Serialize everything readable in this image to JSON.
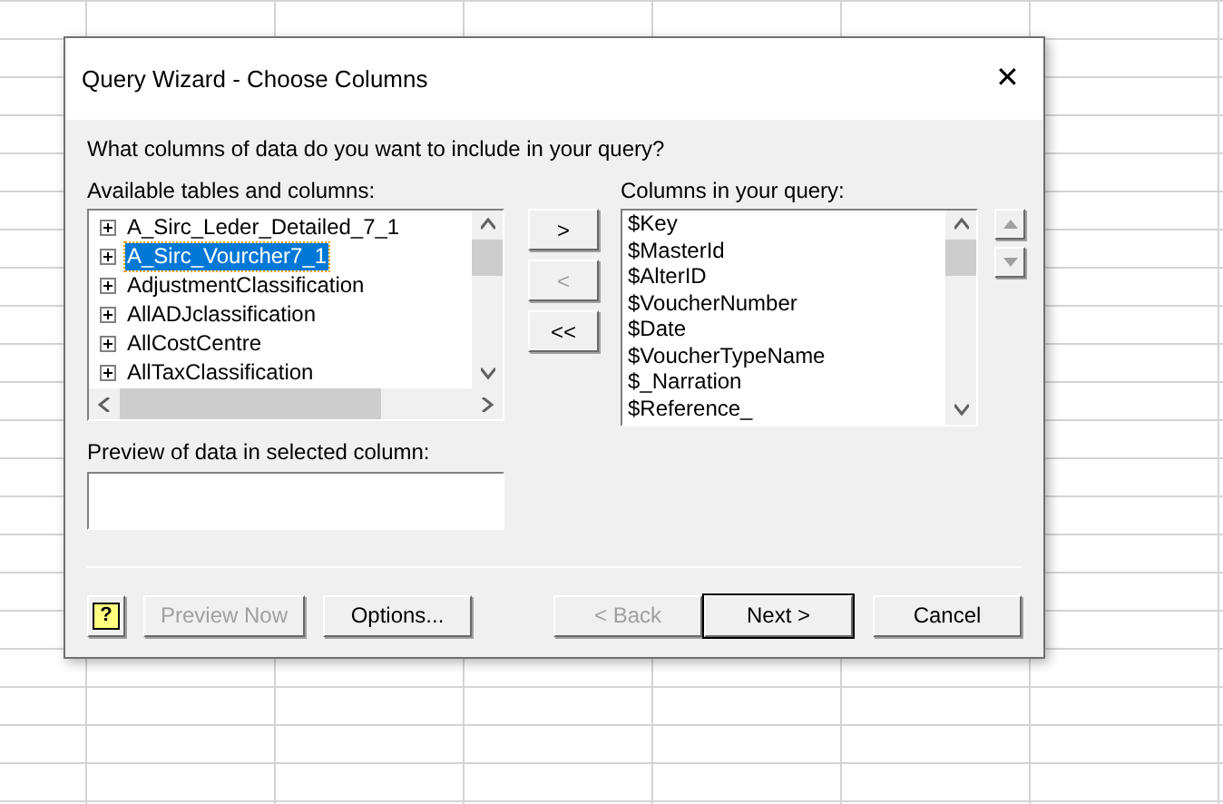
{
  "window": {
    "title": "Query Wizard - Choose Columns",
    "close_glyph": "✕"
  },
  "prompt": "What columns of data do you want to include in your query?",
  "available": {
    "label": "Available tables and columns:",
    "items": [
      {
        "label": "A_Sirc_Leder_Detailed_7_1",
        "selected": false
      },
      {
        "label": "A_Sirc_Vourcher7_1",
        "selected": true
      },
      {
        "label": "AdjustmentClassification",
        "selected": false
      },
      {
        "label": "AllADJclassification",
        "selected": false
      },
      {
        "label": "AllCostCentre",
        "selected": false
      },
      {
        "label": "AllTaxClassification",
        "selected": false
      }
    ]
  },
  "move_buttons": [
    {
      "label": ">",
      "disabled": false
    },
    {
      "label": "<",
      "disabled": true
    },
    {
      "label": "<<",
      "disabled": false
    }
  ],
  "query_columns": {
    "label": "Columns in your query:",
    "items": [
      "$Key",
      "$MasterId",
      "$AlterID",
      "$VoucherNumber",
      "$Date",
      "$VoucherTypeName",
      "$_Narration",
      "$Reference_"
    ]
  },
  "order_buttons": [
    {
      "kind": "up",
      "disabled": true
    },
    {
      "kind": "down",
      "disabled": true
    }
  ],
  "preview": {
    "label": "Preview of data in selected column:"
  },
  "help_glyph": "?",
  "footer_buttons": [
    {
      "label": "Preview Now",
      "disabled": true,
      "default": false
    },
    {
      "label": "Options...",
      "disabled": false,
      "default": false
    },
    {
      "label": "< Back",
      "disabled": true,
      "default": false
    },
    {
      "label": "Next >",
      "disabled": false,
      "default": true
    },
    {
      "label": "Cancel",
      "disabled": false,
      "default": false
    }
  ]
}
